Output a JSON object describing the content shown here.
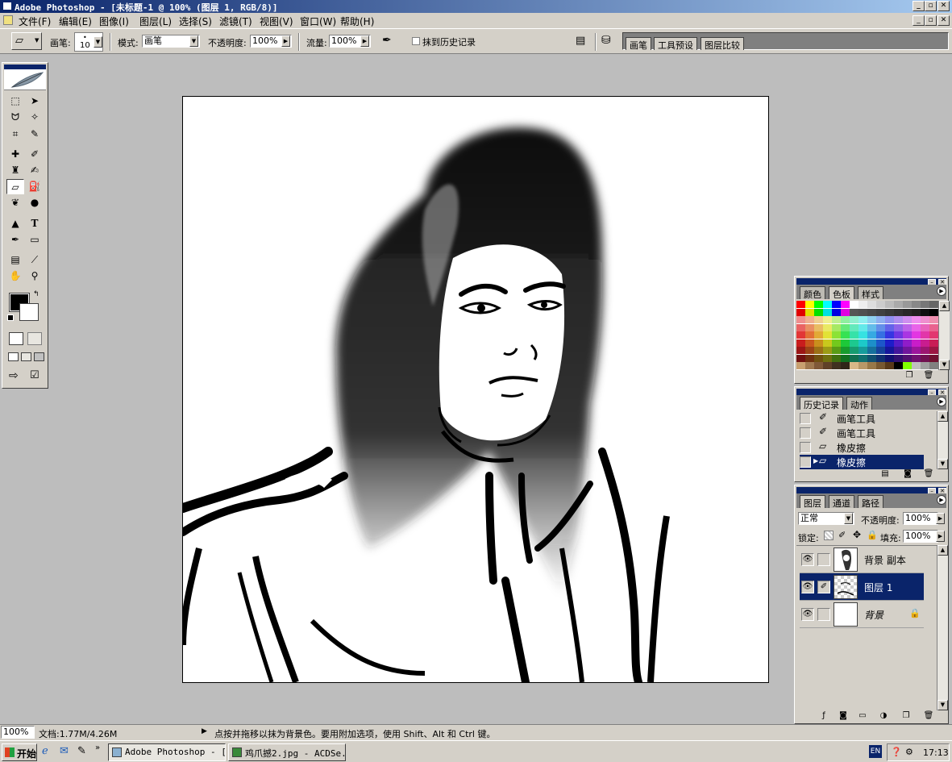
{
  "window": {
    "title": "Adobe Photoshop - [未标题-1 @ 100% (图层 1, RGB/8)]",
    "controls": [
      "_",
      "▫",
      "✕"
    ]
  },
  "menu": [
    "文件(F)",
    "编辑(E)",
    "图像(I)",
    "图层(L)",
    "选择(S)",
    "滤镜(T)",
    "视图(V)",
    "窗口(W)",
    "帮助(H)"
  ],
  "options": {
    "brush_label": "画笔:",
    "brush_size": "10",
    "mode_label": "模式:",
    "mode_value": "画笔",
    "opacity_label": "不透明度:",
    "opacity_value": "100%",
    "flow_label": "流量:",
    "flow_value": "100%",
    "erase_history_label": "抹到历史记录"
  },
  "palette_well": [
    "画笔",
    "工具预设",
    "图层比较"
  ],
  "swatches_panel": {
    "tabs": [
      "颜色",
      "色板",
      "样式"
    ],
    "active_tab": "色板"
  },
  "history_panel": {
    "tabs": [
      "历史记录",
      "动作"
    ],
    "items": [
      {
        "label": "画笔工具",
        "icon": "brush-icon"
      },
      {
        "label": "画笔工具",
        "icon": "brush-icon"
      },
      {
        "label": "橡皮擦",
        "icon": "eraser-icon"
      },
      {
        "label": "橡皮擦",
        "icon": "eraser-icon"
      }
    ],
    "selected_index": 3
  },
  "layers_panel": {
    "tabs": [
      "图层",
      "通道",
      "路径"
    ],
    "blend_mode": "正常",
    "opacity_label": "不透明度:",
    "opacity_value": "100%",
    "lock_label": "锁定:",
    "fill_label": "填充:",
    "fill_value": "100%",
    "layers": [
      {
        "name": "背景 副本"
      },
      {
        "name": "图层 1"
      },
      {
        "name": "背景"
      }
    ],
    "selected_index": 1
  },
  "status": {
    "zoom": "100%",
    "doc": "文档:1.77M/4.26M",
    "hint": "点按并拖移以抹为背景色。要用附加选项，使用 Shift、Alt 和 Ctrl 键。"
  },
  "taskbar": {
    "start": "开始",
    "tasks": [
      "Adobe Photoshop - [...",
      "鸡爪撼2.jpg - ACDSe..."
    ],
    "lang": "EN",
    "clock": "17:13"
  },
  "colors": {
    "title_blue": "#0a246a",
    "face_gray": "#d4d0c8",
    "workspace": "#bdbdbd"
  }
}
